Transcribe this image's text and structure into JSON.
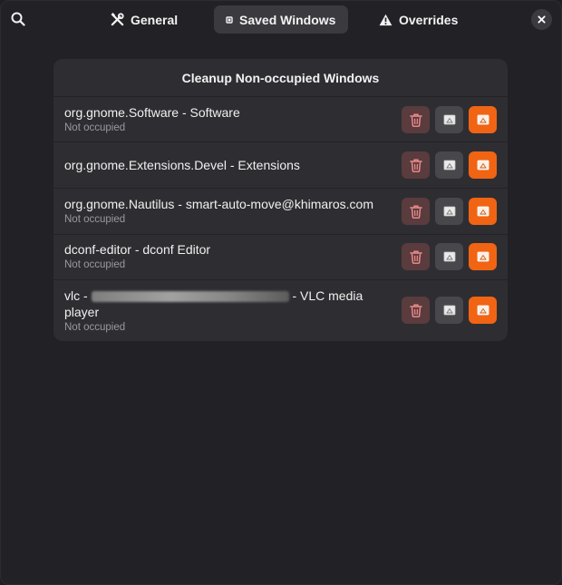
{
  "header": {
    "tabs": [
      {
        "label": "General",
        "icon": "tools-icon"
      },
      {
        "label": "Saved Windows",
        "icon": "window-icon"
      },
      {
        "label": "Overrides",
        "icon": "warning-icon"
      }
    ],
    "active_tab": "Saved Windows"
  },
  "card": {
    "title": "Cleanup Non-occupied Windows",
    "rows": [
      {
        "title": "org.gnome.Software - Software",
        "subtitle": "Not occupied"
      },
      {
        "title": "org.gnome.Extensions.Devel - Extensions",
        "subtitle": ""
      },
      {
        "title": "org.gnome.Nautilus - smart-auto-move@khimaros.com",
        "subtitle": "Not occupied"
      },
      {
        "title": "dconf-editor - dconf Editor",
        "subtitle": "Not occupied"
      },
      {
        "title_prefix": "vlc - ",
        "title_suffix": " - VLC media",
        "title_line2": "player",
        "subtitle": "Not occupied"
      }
    ]
  },
  "colors": {
    "accent": "#f06414",
    "delete_bg": "#5a3b3e",
    "delete_icon": "#f08f8f",
    "button_bg": "#47474c",
    "card_bg": "#2e2e32",
    "window_bg": "#222226"
  }
}
